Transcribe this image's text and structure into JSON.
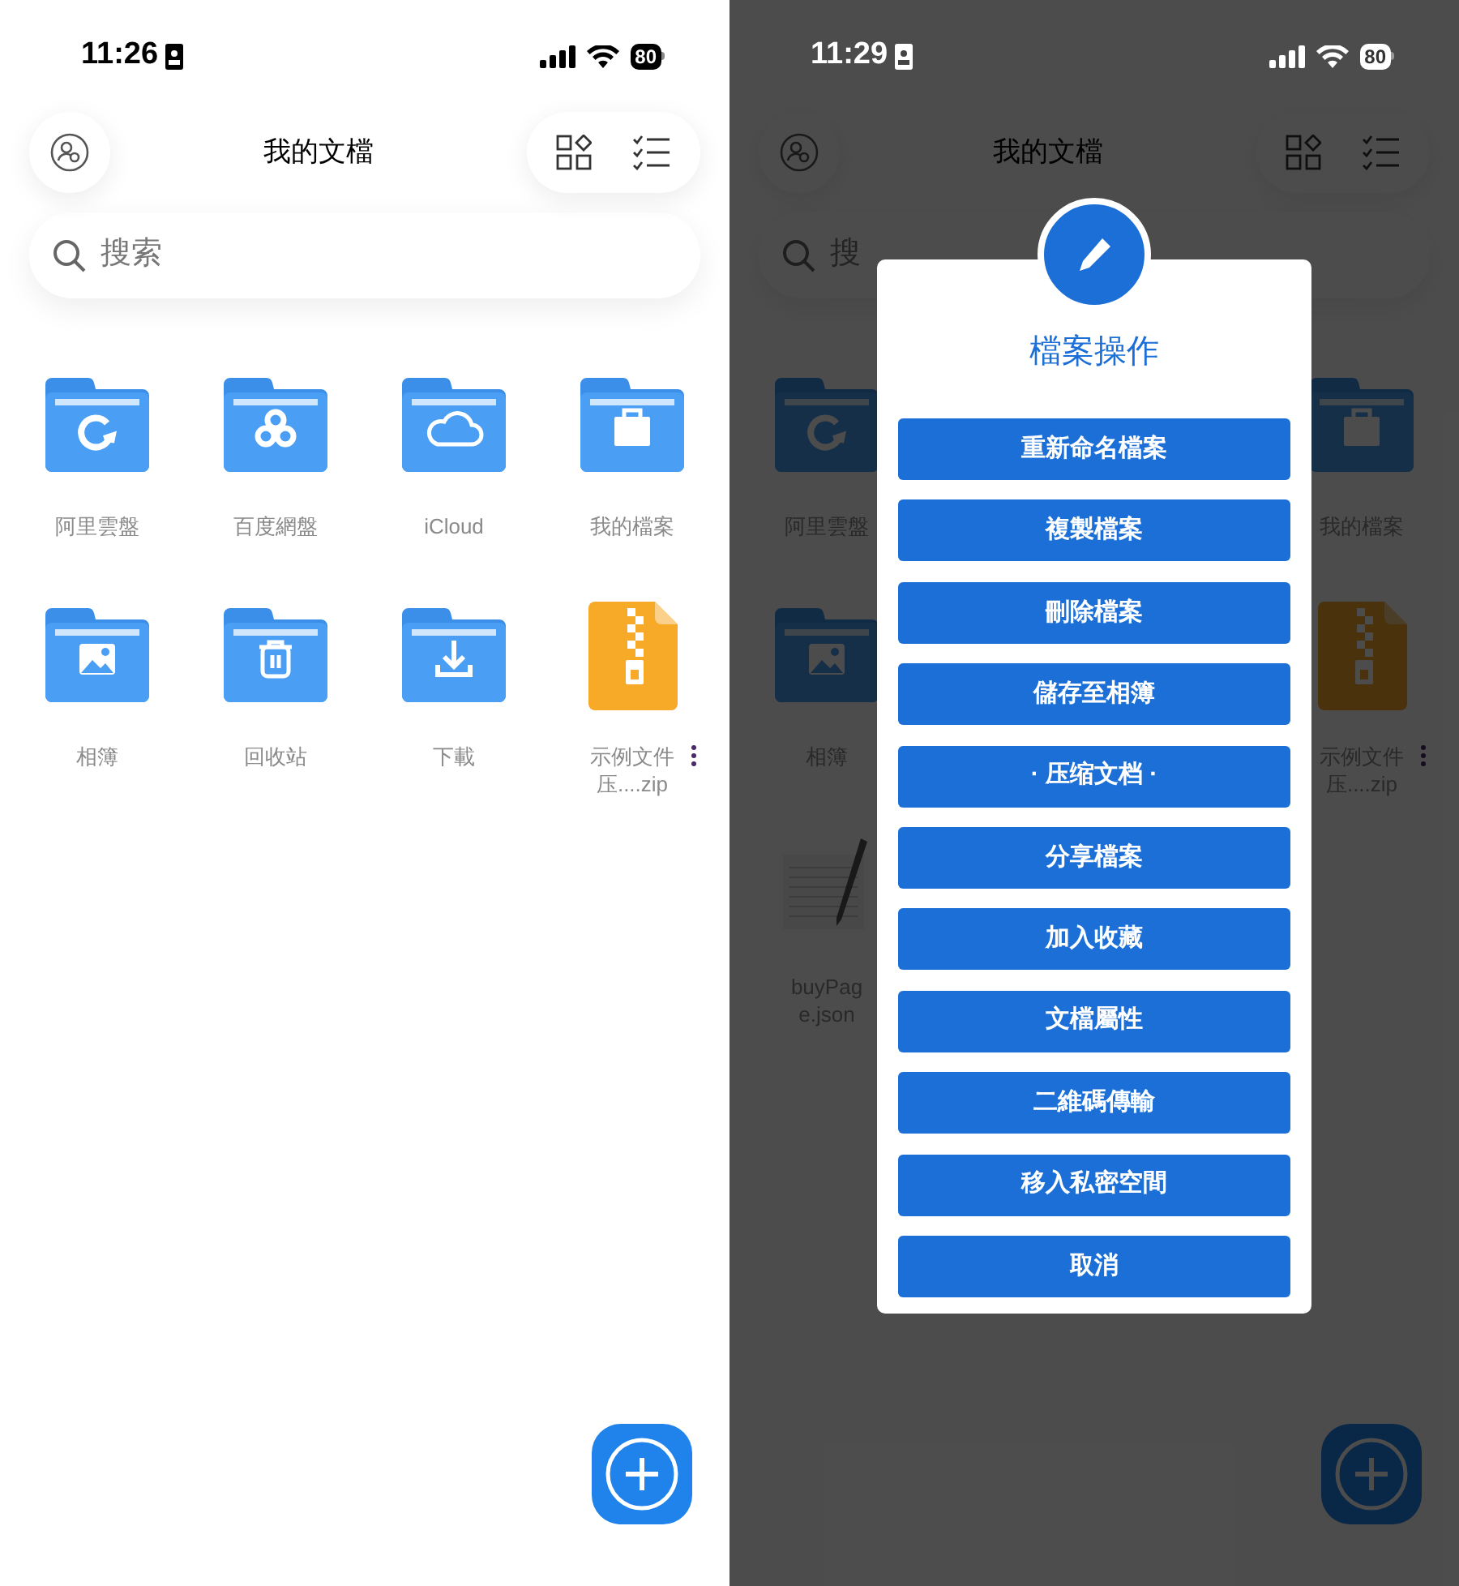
{
  "screens": [
    {
      "status_bar": {
        "time": "11:26",
        "battery": "80",
        "light": false
      },
      "header": {
        "title": "我的文檔"
      },
      "search": {
        "placeholder": "搜索"
      },
      "grid": [
        [
          {
            "label": "阿里雲盤",
            "kind": "aliyun"
          },
          {
            "label": "百度網盤",
            "kind": "baidu"
          },
          {
            "label": "iCloud",
            "kind": "cloud"
          },
          {
            "label": "我的檔案",
            "kind": "briefcase"
          }
        ],
        [
          {
            "label": "相簿",
            "kind": "photo"
          },
          {
            "label": "回收站",
            "kind": "trash"
          },
          {
            "label": "下載",
            "kind": "download"
          },
          {
            "label": "示例文件压....zip",
            "kind": "zip"
          }
        ]
      ]
    },
    {
      "status_bar": {
        "time": "11:29",
        "battery": "80",
        "light": true
      },
      "header": {
        "title": "我的文檔"
      },
      "search": {
        "placeholder": "搜"
      },
      "grid": [
        [
          {
            "label": "阿里雲盤",
            "kind": "aliyun"
          },
          {
            "kind": "empty"
          },
          {
            "kind": "empty"
          },
          {
            "label": "我的檔案",
            "kind": "briefcase"
          }
        ],
        [
          {
            "label": "相簿",
            "kind": "photo"
          },
          {
            "kind": "empty"
          },
          {
            "kind": "empty"
          },
          {
            "label": "示例文件压....zip",
            "kind": "zip"
          }
        ],
        [
          {
            "label": "buyPage.json",
            "kind": "doc"
          }
        ]
      ],
      "dialog": {
        "title": "檔案操作",
        "buttons": [
          "重新命名檔案",
          "複製檔案",
          "刪除檔案",
          "儲存至相簿",
          "· 压缩文档 ·",
          "分享檔案",
          "加入收藏",
          "文檔屬性",
          "二維碼傳輸",
          "移入私密空間",
          "取消"
        ]
      }
    }
  ]
}
